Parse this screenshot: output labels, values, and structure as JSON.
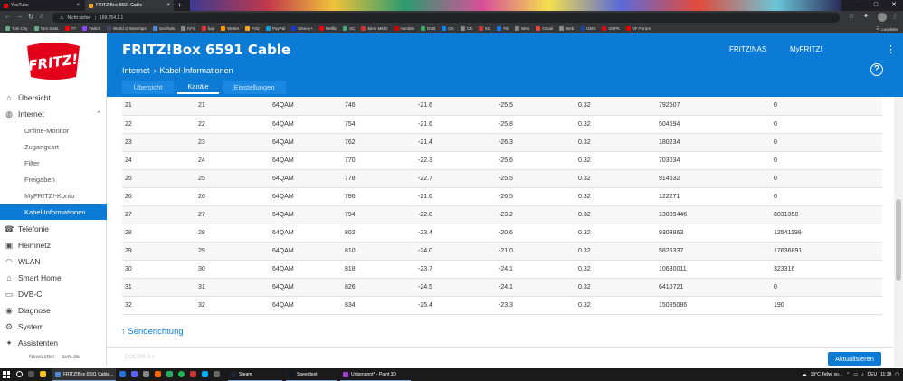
{
  "browser": {
    "tabs": [
      {
        "label": "YouTube"
      },
      {
        "label": "FRITZ!Box 6591 Cable",
        "active": true
      }
    ],
    "url_warning": "Nicht sicher",
    "url": "169.254.1.1",
    "bookmarks": [
      "Tom City",
      "Tom Stats",
      "YT",
      "Twitch",
      "World of Warships",
      "Geizhals",
      "KFS",
      "bay",
      "Wetter",
      "Fritz",
      "PayPal",
      "Disney+",
      "Netflix",
      "SC",
      "Mein MMO",
      "Humble",
      "DVB",
      "GS",
      "CB",
      "KD",
      "FB",
      "Web",
      "Gmail",
      "Web",
      "GMX",
      "OSPK",
      "VF Forum"
    ],
    "reading_list": "Leseliste"
  },
  "header": {
    "title": "FRITZ!Box 6591 Cable",
    "links": [
      "FRITZ!NAS",
      "MyFRITZ!"
    ],
    "breadcrumb": [
      "Internet",
      "Kabel-Informationen"
    ],
    "help": "?",
    "logo_text": "FRITZ!",
    "tabs": [
      {
        "label": "Übersicht"
      },
      {
        "label": "Kanäle",
        "active": true
      },
      {
        "label": "Einstellungen"
      }
    ]
  },
  "sidebar": {
    "items": [
      {
        "label": "Übersicht",
        "icon": "home-icon"
      },
      {
        "label": "Internet",
        "icon": "globe-icon",
        "expanded": true
      },
      {
        "label": "Telefonie",
        "icon": "phone-icon"
      },
      {
        "label": "Heimnetz",
        "icon": "network-icon"
      },
      {
        "label": "WLAN",
        "icon": "wifi-icon"
      },
      {
        "label": "Smart Home",
        "icon": "smarthome-icon"
      },
      {
        "label": "DVB-C",
        "icon": "tv-icon"
      },
      {
        "label": "Diagnose",
        "icon": "diagnose-icon"
      },
      {
        "label": "System",
        "icon": "system-icon"
      },
      {
        "label": "Assistenten",
        "icon": "wizard-icon"
      }
    ],
    "internet_sub": [
      "Online-Monitor",
      "Zugangsart",
      "Filter",
      "Freigaben",
      "MyFRITZ!-Konto",
      "Kabel-Informationen"
    ],
    "footer": [
      "Newsletter",
      "avm.de"
    ]
  },
  "channels": [
    [
      "21",
      "21",
      "64QAM",
      "746",
      "-21.6",
      "-25.5",
      "0.32",
      "792507",
      "0"
    ],
    [
      "22",
      "22",
      "64QAM",
      "754",
      "-21.6",
      "-25.8",
      "0.32",
      "504694",
      "0"
    ],
    [
      "23",
      "23",
      "64QAM",
      "762",
      "-21.4",
      "-26.3",
      "0.32",
      "180234",
      "0"
    ],
    [
      "24",
      "24",
      "64QAM",
      "770",
      "-22.3",
      "-25.6",
      "0.32",
      "703034",
      "0"
    ],
    [
      "25",
      "25",
      "64QAM",
      "778",
      "-22.7",
      "-25.5",
      "0.32",
      "914632",
      "0"
    ],
    [
      "26",
      "26",
      "64QAM",
      "786",
      "-21.6",
      "-26.5",
      "0.32",
      "122271",
      "0"
    ],
    [
      "27",
      "27",
      "64QAM",
      "794",
      "-22.8",
      "-23.2",
      "0.32",
      "13009446",
      "8031358"
    ],
    [
      "28",
      "28",
      "64QAM",
      "802",
      "-23.4",
      "-20.6",
      "0.32",
      "9303863",
      "12541199"
    ],
    [
      "29",
      "29",
      "64QAM",
      "810",
      "-24.0",
      "-21.0",
      "0.32",
      "5826337",
      "17636891"
    ],
    [
      "30",
      "30",
      "64QAM",
      "818",
      "-23.7",
      "-24.1",
      "0.32",
      "10680011",
      "323316"
    ],
    [
      "31",
      "31",
      "64QAM",
      "826",
      "-24.5",
      "-24.1",
      "0.32",
      "6410721",
      "0"
    ],
    [
      "32",
      "32",
      "64QAM",
      "834",
      "-25.4",
      "-23.3",
      "0.32",
      "15085086",
      "190"
    ]
  ],
  "content": {
    "senderichtung": "↑ Senderichtung",
    "docsis": "DOCSIS 3.1",
    "refresh_button": "Aktualisieren"
  },
  "taskbar": {
    "apps": [
      "FRITZ!Box 6591 Cable...",
      "Steam",
      "Speedtest",
      "Unbenannt* - Paint 3D"
    ],
    "weather": "19°C  Teilw. so...",
    "lang": "DEU",
    "time": "11:38"
  },
  "colors": {
    "brand_blue": "#0c7bd6",
    "logo_red": "#e2001a"
  }
}
